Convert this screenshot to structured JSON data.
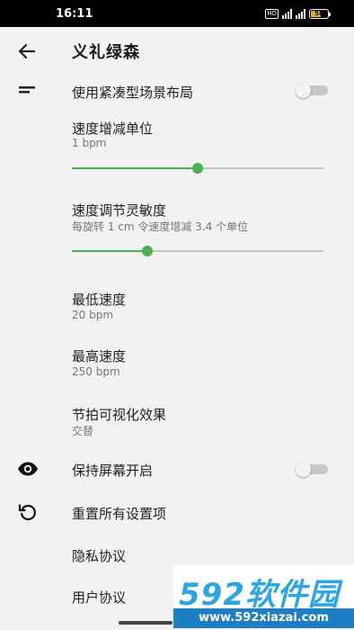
{
  "status_bar": {
    "time": "16:11",
    "hd_label": "HD",
    "battery": "58"
  },
  "header": {
    "title": "义礼绿森"
  },
  "settings": {
    "compact_layout": {
      "label": "使用紧凑型场景布局",
      "enabled": false
    },
    "speed_step": {
      "label": "速度增减单位",
      "value": "1 bpm",
      "slider_fraction": 0.5
    },
    "speed_sensitivity": {
      "label": "速度调节灵敏度",
      "value": "每旋转 1 cm 令速度增减 3.4 个单位",
      "slider_fraction": 0.3
    },
    "min_speed": {
      "label": "最低速度",
      "value": "20 bpm"
    },
    "max_speed": {
      "label": "最高速度",
      "value": "250 bpm"
    },
    "beat_visual": {
      "label": "节拍可视化效果",
      "value": "交替"
    },
    "keep_screen_on": {
      "label": "保持屏幕开启",
      "enabled": false
    },
    "reset_all": {
      "label": "重置所有设置项"
    },
    "privacy": {
      "label": "隐私协议"
    },
    "user_agreement": {
      "label": "用户协议"
    }
  },
  "watermark": {
    "logo": "592软件园",
    "url": "www.592xiazai.com"
  },
  "colors": {
    "accent": "#4caf50",
    "background": "#f2f2f2",
    "status_bar": "#000000"
  },
  "icons": {
    "back": "arrow-left",
    "compact": "compact-lines",
    "keep_screen": "eye",
    "reset": "restore-arrow"
  }
}
